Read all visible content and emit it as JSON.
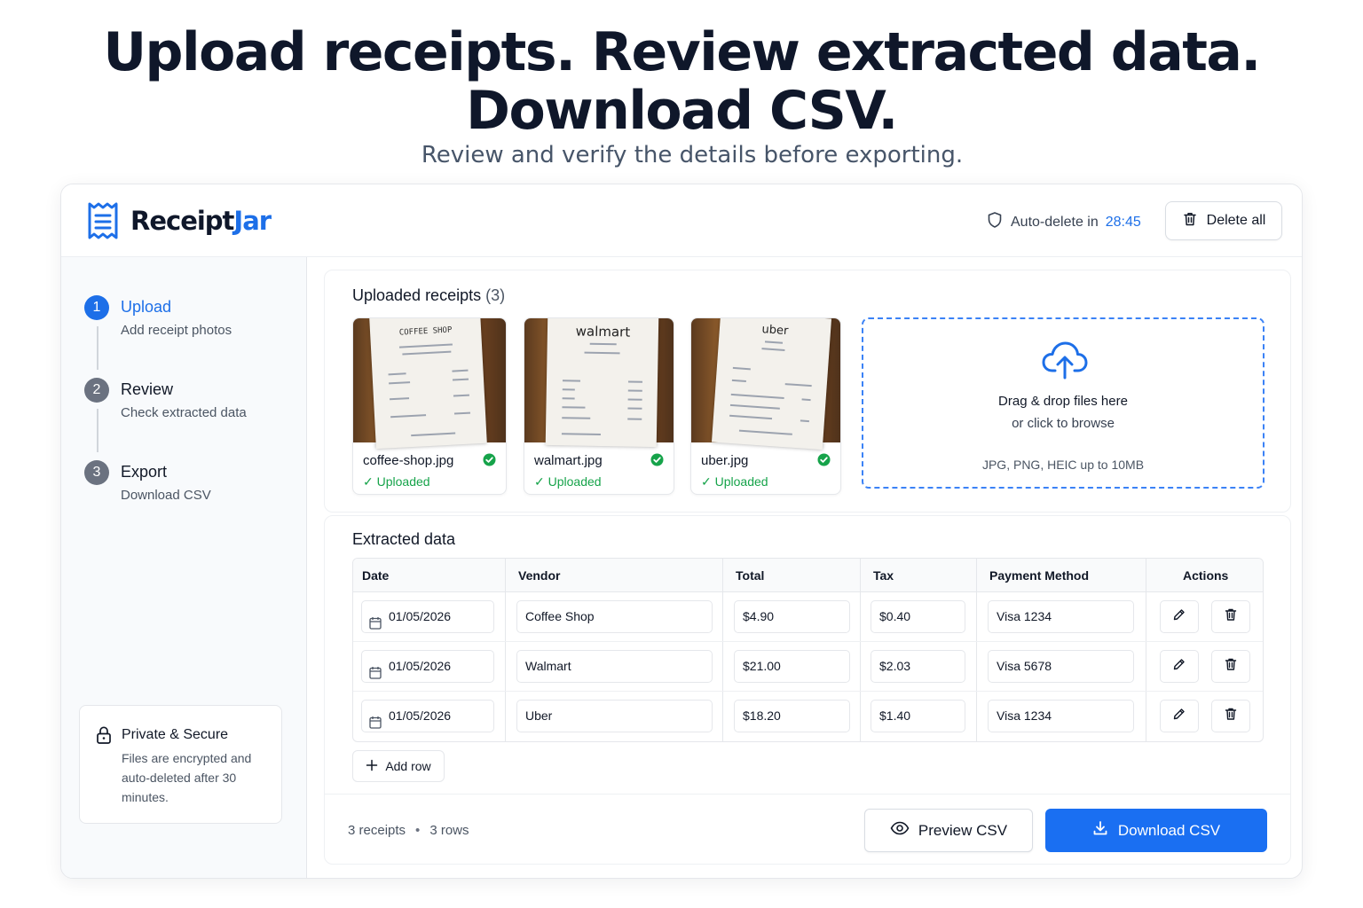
{
  "hero": {
    "title_line1": "Upload receipts. Review extracted data.",
    "title_line2": "Download CSV.",
    "subtitle": "Review and verify the details before exporting."
  },
  "header": {
    "brand_part1": "Receipt",
    "brand_part2": "Jar",
    "auto_delete_label": "Auto-delete in",
    "auto_delete_time": "28:45",
    "delete_all_label": "Delete all"
  },
  "sidebar": {
    "steps": [
      {
        "num": "1",
        "title": "Upload",
        "desc": "Add receipt photos"
      },
      {
        "num": "2",
        "title": "Review",
        "desc": "Check extracted data"
      },
      {
        "num": "3",
        "title": "Export",
        "desc": "Download CSV"
      }
    ],
    "secure": {
      "title": "Private & Secure",
      "text": "Files are encrypted and auto-deleted after 30 minutes."
    }
  },
  "uploads": {
    "title": "Uploaded receipts",
    "count": "(3)",
    "files": [
      {
        "name": "coffee-shop.jpg",
        "status": "Uploaded",
        "header": "COFFEE SHOP"
      },
      {
        "name": "walmart.jpg",
        "status": "Uploaded",
        "header": "walmart"
      },
      {
        "name": "uber.jpg",
        "status": "Uploaded",
        "header": "uber"
      }
    ],
    "dropzone": {
      "line1": "Drag & drop files here",
      "line2": "or click to browse",
      "formats": "JPG, PNG, HEIC up to 10MB"
    }
  },
  "extracted": {
    "title": "Extracted data",
    "columns": [
      "Date",
      "Vendor",
      "Total",
      "Tax",
      "Payment Method",
      "Actions"
    ],
    "rows": [
      {
        "date": "01/05/2026",
        "vendor": "Coffee Shop",
        "total": "$4.90",
        "tax": "$0.40",
        "payment": "Visa 1234"
      },
      {
        "date": "01/05/2026",
        "vendor": "Walmart",
        "total": "$21.00",
        "tax": "$2.03",
        "payment": "Visa 5678"
      },
      {
        "date": "01/05/2026",
        "vendor": "Uber",
        "total": "$18.20",
        "tax": "$1.40",
        "payment": "Visa 1234"
      }
    ],
    "add_row_label": "Add row"
  },
  "footer": {
    "receipts_count": "3 receipts",
    "separator": "•",
    "rows_count": "3 rows",
    "preview_label": "Preview CSV",
    "download_label": "Download CSV"
  },
  "colors": {
    "accent": "#1d6fe8",
    "success": "#16a34a",
    "download_button": "#1a6ff2"
  }
}
